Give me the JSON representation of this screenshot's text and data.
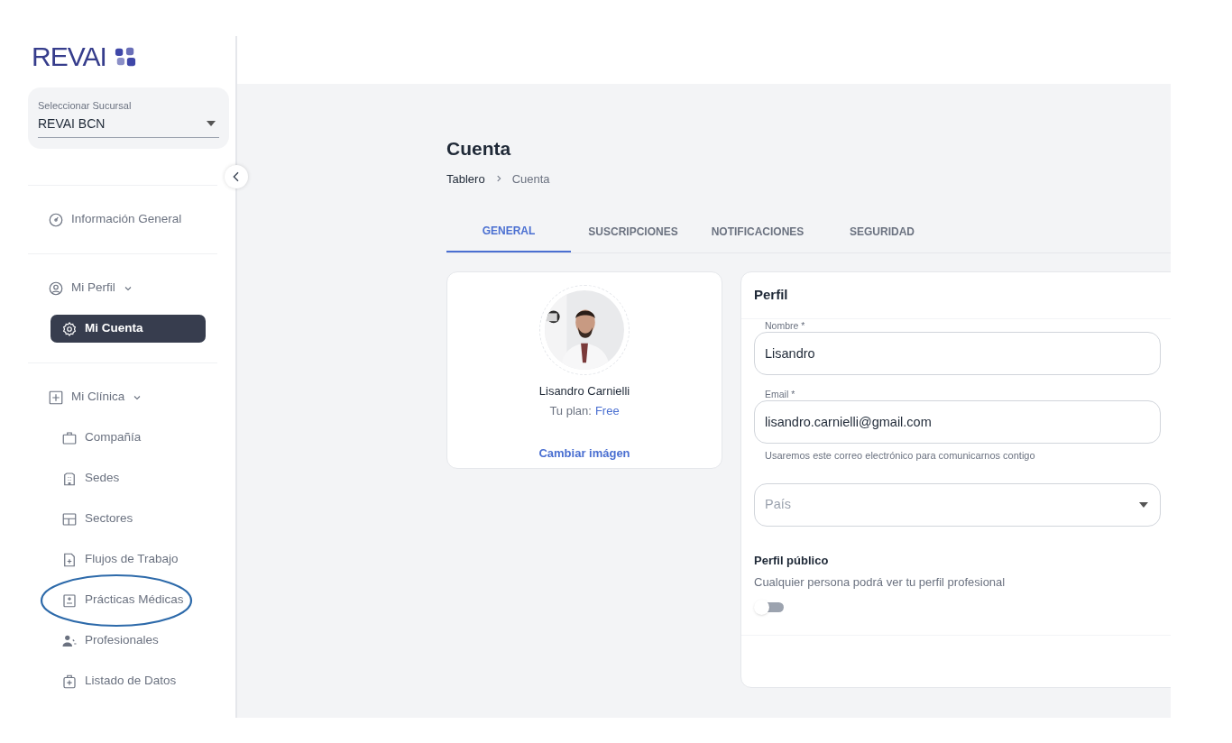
{
  "logo": {
    "text": "REVAI"
  },
  "branch_select": {
    "label": "Seleccionar Sucursal",
    "value": "REVAI BCN"
  },
  "sidebar": {
    "sections": [
      {
        "items": [
          {
            "label": "Información General",
            "selected": false
          }
        ]
      },
      {
        "items": [
          {
            "label": "Mi Perfil",
            "selected": false,
            "expanded": true,
            "children": [
              {
                "label": "Mi Cuenta",
                "selected": true,
                "circled": false
              }
            ]
          }
        ]
      },
      {
        "items": [
          {
            "label": "Mi Clínica",
            "selected": false,
            "expanded": true,
            "children": [
              {
                "label": "Compañía",
                "selected": false,
                "circled": false
              },
              {
                "label": "Sedes",
                "selected": false,
                "circled": false
              },
              {
                "label": "Sectores",
                "selected": false,
                "circled": false
              },
              {
                "label": "Flujos de Trabajo",
                "selected": false,
                "circled": false
              },
              {
                "label": "Prácticas Médicas",
                "selected": false,
                "circled": true
              },
              {
                "label": "Profesionales",
                "selected": false,
                "circled": false
              },
              {
                "label": "Listado de Datos",
                "selected": false,
                "circled": false
              }
            ]
          }
        ]
      }
    ]
  },
  "page": {
    "title": "Cuenta",
    "breadcrumb": [
      "Tablero",
      "Cuenta"
    ]
  },
  "tabs": [
    {
      "label": "GENERAL",
      "selected": true
    },
    {
      "label": "SUSCRIPCIONES",
      "selected": false
    },
    {
      "label": "NOTIFICACIONES",
      "selected": false
    },
    {
      "label": "SEGURIDAD",
      "selected": false
    }
  ],
  "profile_card": {
    "name": "Lisandro Carnielli",
    "plan_label": "Tu plan:",
    "plan": "Free",
    "change_image": "Cambiar imágen"
  },
  "profile_form": {
    "title": "Perfil",
    "fields": [
      {
        "kind": "text",
        "label": "Nombre *",
        "value": "Lisandro"
      },
      {
        "kind": "text",
        "label": "Email *",
        "value": "lisandro.carnielli@gmail.com",
        "helper": "Usaremos este correo electrónico para comunicarnos contigo"
      },
      {
        "kind": "select",
        "placeholder": "País"
      }
    ],
    "public_profile": {
      "title": "Perfil público",
      "description": "Cualquier persona podrá ver tu perfil profesional",
      "on": false
    }
  }
}
